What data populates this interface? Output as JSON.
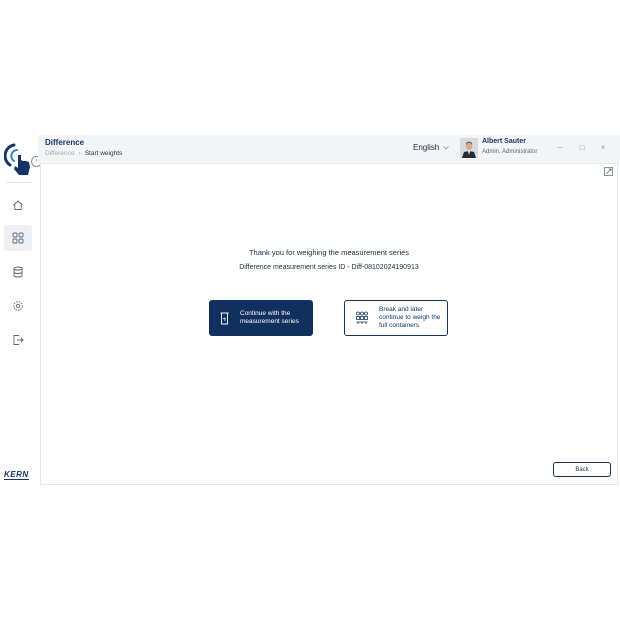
{
  "header": {
    "title": "Difference",
    "breadcrumb": [
      "Difference",
      "Start weights"
    ],
    "language": "English",
    "user_name": "Albert Sauter",
    "user_role": "Admin, Administrator"
  },
  "window_controls": {
    "minimize": "–",
    "maximize": "□",
    "close": "×"
  },
  "sidebar": {
    "items": [
      {
        "name": "home",
        "icon": "home-icon",
        "active": false
      },
      {
        "name": "applications",
        "icon": "grid-icon",
        "active": true
      },
      {
        "name": "database",
        "icon": "database-icon",
        "active": false
      },
      {
        "name": "settings",
        "icon": "gear-icon",
        "active": false
      },
      {
        "name": "logout",
        "icon": "logout-icon",
        "active": false
      }
    ],
    "brand": "KERN"
  },
  "main": {
    "thanks_message": "Thank you  for weighing the measurement series",
    "series_id": "Difference measurement series ID - Diff-08102024190913",
    "continue_button": "Continue with the measurement series",
    "break_button": "Break and later continue to weigh the full containers",
    "back_button": "Back"
  },
  "colors": {
    "primary": "#12305f",
    "accent": "#2c7fd1"
  }
}
